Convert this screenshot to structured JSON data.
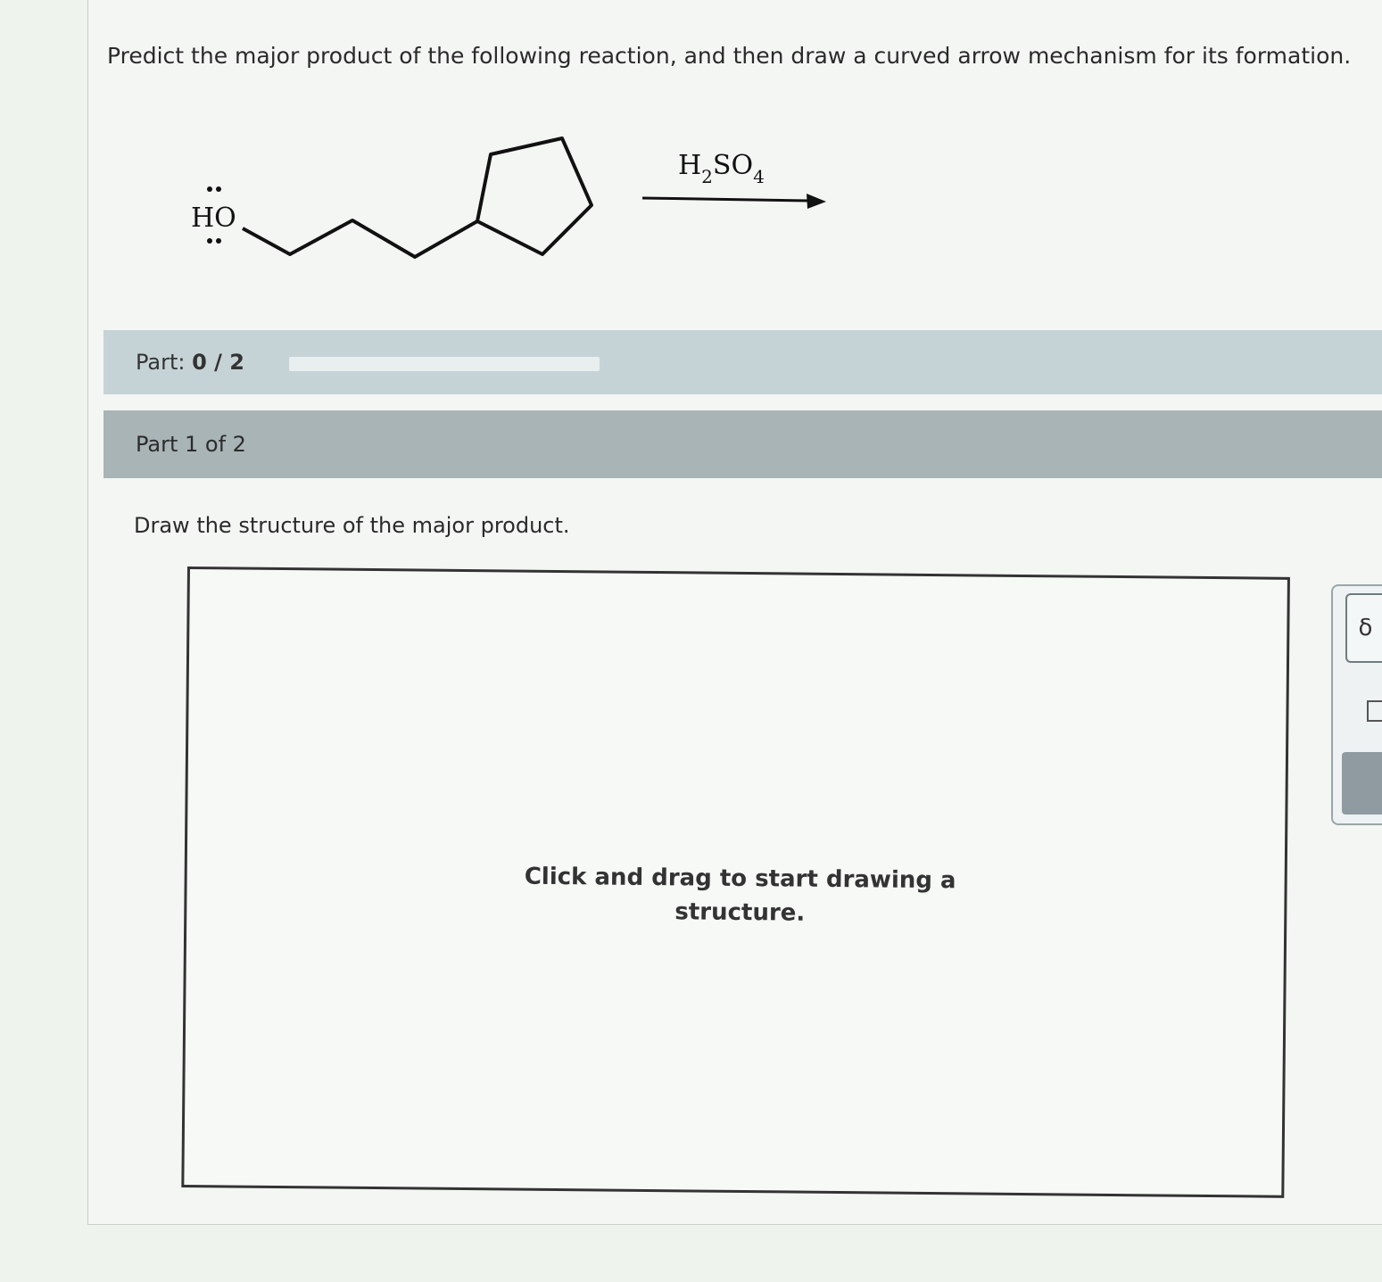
{
  "question": {
    "text": "Predict the major product of the following reaction, and then draw a curved arrow mechanism for its formation."
  },
  "reaction": {
    "reactant_label": "HO",
    "reagent_main": "H",
    "reagent_sub": "2",
    "reagent_main2": "SO",
    "reagent_sub2": "4"
  },
  "progress": {
    "label": "Part:",
    "score": "0 / 2",
    "fraction": 0
  },
  "part": {
    "header": "Part 1 of 2",
    "instruction": "Draw the structure of the major product."
  },
  "canvas": {
    "hint": "Click and drag to start drawing a structure."
  },
  "toolbar": {
    "tool1_icon": "lasso-icon"
  }
}
